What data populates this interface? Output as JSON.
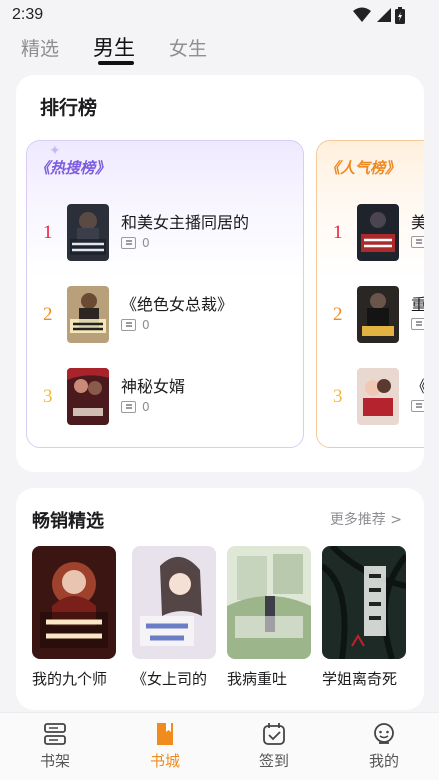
{
  "status": {
    "time": "2:39"
  },
  "top_tabs": [
    {
      "label": "精选"
    },
    {
      "label": "男生"
    },
    {
      "label": "女生"
    }
  ],
  "ranking": {
    "title": "排行榜",
    "boards": [
      {
        "badge": "《热搜榜》",
        "items": [
          {
            "rank": "1",
            "name": "和美女主播同居的",
            "reads": "0"
          },
          {
            "rank": "2",
            "name": "《绝色女总裁》",
            "reads": "0"
          },
          {
            "rank": "3",
            "name": "神秘女婿",
            "reads": "0"
          }
        ]
      },
      {
        "badge": "《人气榜》",
        "items": [
          {
            "rank": "1",
            "name": "美",
            "reads": ""
          },
          {
            "rank": "2",
            "name": "重",
            "reads": ""
          },
          {
            "rank": "3",
            "name": "《",
            "reads": ""
          }
        ]
      }
    ]
  },
  "best": {
    "title": "畅销精选",
    "more": "更多推荐 >",
    "books": [
      {
        "name": "我的九个师"
      },
      {
        "name": "《女上司的"
      },
      {
        "name": "我病重吐"
      },
      {
        "name": "学姐离奇死"
      }
    ]
  },
  "nav": [
    {
      "label": "书架",
      "icon": "bookshelf-icon"
    },
    {
      "label": "书城",
      "icon": "bookstore-icon"
    },
    {
      "label": "签到",
      "icon": "checkin-icon"
    },
    {
      "label": "我的",
      "icon": "profile-icon"
    }
  ],
  "colors": {
    "accent": "#f08c1e",
    "hot": "#7c5ce0"
  }
}
